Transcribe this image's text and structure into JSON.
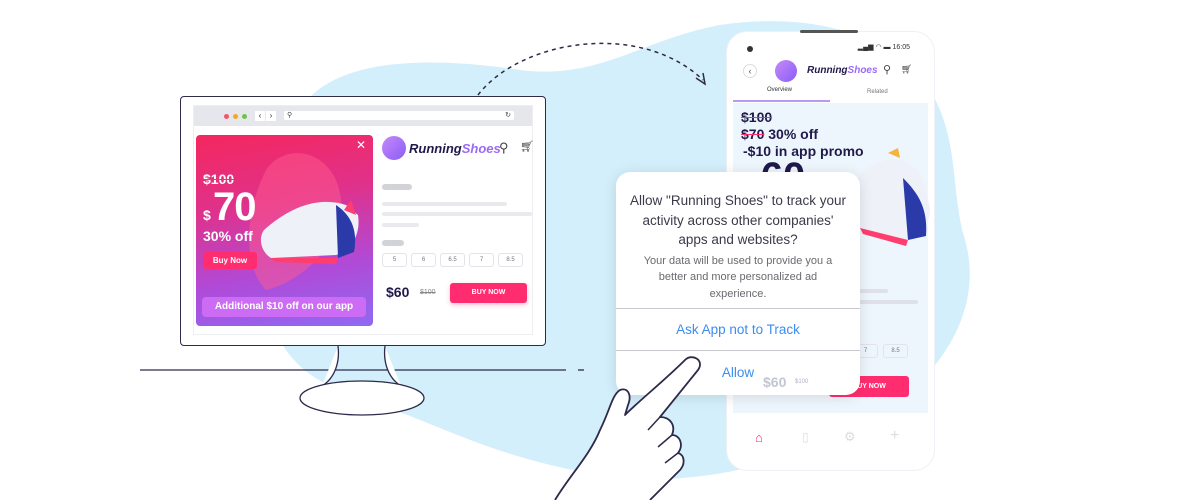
{
  "colors": {
    "accent": "#ff2d6f",
    "purple": "#8b5cf6",
    "dialog_button": "#3b8ef0",
    "background_blob": "#d3effb",
    "outline": "#2d2a4a"
  },
  "desktop": {
    "browser": {
      "url_icon": "search-icon",
      "reload_icon": "reload-icon",
      "back_icon": "chevron-left-icon",
      "forward_icon": "chevron-right-icon"
    },
    "ad": {
      "old_price": "$100",
      "currency": "$",
      "price": "70",
      "discount": "30% off",
      "buy_label": "Buy Now",
      "app_offer": "Additional $10 off on our app",
      "close_icon": "close-icon"
    },
    "brand": {
      "name_a": "Running",
      "name_b": "Shoes"
    },
    "sizes": [
      "5",
      "6",
      "6.5",
      "7",
      "8.5"
    ],
    "price": "$60",
    "old_price": "$100",
    "buy_label": "BUY NOW"
  },
  "phone": {
    "time": "16:05",
    "brand": {
      "name_a": "Running",
      "name_b": "Shoes"
    },
    "tabs": [
      {
        "label": "Overview",
        "active": true
      },
      {
        "label": "Related",
        "active": false
      }
    ],
    "promo": {
      "line1": "$100",
      "line2_strike": "$70",
      "line2_rest": " 30% off",
      "line3": "-$10 in app promo",
      "big_price": "60",
      "currency": "$"
    },
    "sizes": [
      "7",
      "8.5"
    ],
    "price": "$60",
    "old_price": "$100",
    "buy_label": "BUY NOW",
    "nav": [
      "home-icon",
      "bag-icon",
      "gear-icon",
      "plus-icon"
    ]
  },
  "dialog": {
    "title": "Allow \"Running Shoes\" to track your activity across other companies' apps and websites?",
    "message": "Your data will be used to provide you a better and more personalized ad experience.",
    "deny_label": "Ask App not to Track",
    "allow_label": "Allow"
  }
}
